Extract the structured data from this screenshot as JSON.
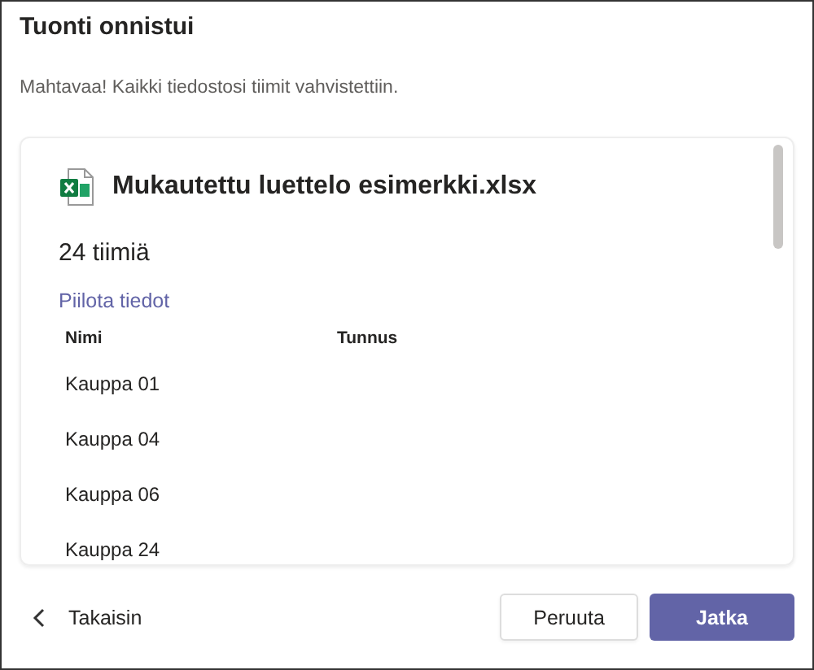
{
  "dialog": {
    "title": "Tuonti onnistui",
    "message": "Mahtavaa! Kaikki tiedostosi tiimit vahvistettiin."
  },
  "file": {
    "name": "Mukautettu luettelo esimerkki.xlsx",
    "count": "24 tiimiä",
    "toggle_link": "Piilota tiedot"
  },
  "table": {
    "columns": [
      "Nimi",
      "Tunnus"
    ],
    "rows": [
      [
        "Kauppa 01"
      ],
      [
        "Kauppa 04"
      ],
      [
        "Kauppa 06"
      ],
      [
        "Kauppa 24"
      ]
    ]
  },
  "footer": {
    "back": "Takaisin",
    "buttons": [
      {
        "label": "Peruuta",
        "kind": "secondary"
      },
      {
        "label": "Jatka",
        "kind": "primary"
      }
    ]
  }
}
